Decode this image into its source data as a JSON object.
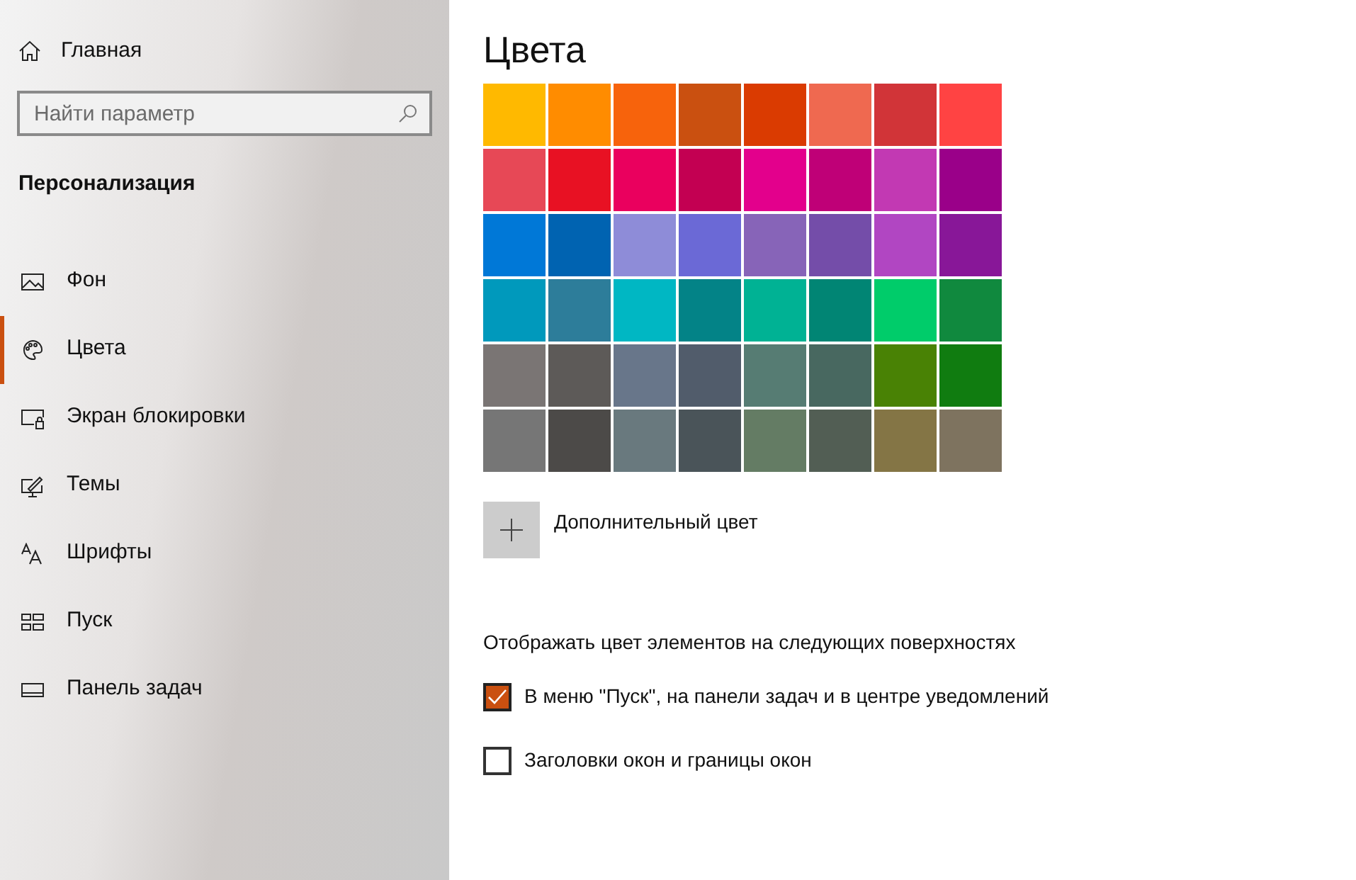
{
  "sidebar": {
    "home": "Главная",
    "search": {
      "placeholder": "Найти параметр"
    },
    "section": "Персонализация",
    "items": [
      {
        "label": "Фон",
        "kind": "background",
        "selected": false
      },
      {
        "label": "Цвета",
        "kind": "colors",
        "selected": true
      },
      {
        "label": "Экран блокировки",
        "kind": "lock",
        "selected": false
      },
      {
        "label": "Темы",
        "kind": "themes",
        "selected": false
      },
      {
        "label": "Шрифты",
        "kind": "fonts",
        "selected": false
      },
      {
        "label": "Пуск",
        "kind": "start",
        "selected": false
      },
      {
        "label": "Панель задач",
        "kind": "taskbar",
        "selected": false
      }
    ]
  },
  "main": {
    "title": "Цвета",
    "swatches": [
      {
        "color": "#ffb900"
      },
      {
        "color": "#ff8c00"
      },
      {
        "color": "#f7630c"
      },
      {
        "color": "#ca5010"
      },
      {
        "color": "#da3b01"
      },
      {
        "color": "#ef6950"
      },
      {
        "color": "#d13438"
      },
      {
        "color": "#ff4343"
      },
      {
        "color": "#e74856"
      },
      {
        "color": "#e81123"
      },
      {
        "color": "#ea005e"
      },
      {
        "color": "#c30052"
      },
      {
        "color": "#e3008c"
      },
      {
        "color": "#bf0077"
      },
      {
        "color": "#c239b3"
      },
      {
        "color": "#9a0089"
      },
      {
        "color": "#0078d7"
      },
      {
        "color": "#0063b1"
      },
      {
        "color": "#8e8cd8"
      },
      {
        "color": "#6b69d6"
      },
      {
        "color": "#8764b8"
      },
      {
        "color": "#744da9"
      },
      {
        "color": "#b146c2"
      },
      {
        "color": "#881798"
      },
      {
        "color": "#0099bc"
      },
      {
        "color": "#2d7d9a"
      },
      {
        "color": "#00b7c3"
      },
      {
        "color": "#038387"
      },
      {
        "color": "#00b294"
      },
      {
        "color": "#018574"
      },
      {
        "color": "#00cc6a"
      },
      {
        "color": "#10893e"
      },
      {
        "color": "#7a7574"
      },
      {
        "color": "#5d5a58"
      },
      {
        "color": "#68768a"
      },
      {
        "color": "#515c6b"
      },
      {
        "color": "#567c73"
      },
      {
        "color": "#486860"
      },
      {
        "color": "#498205"
      },
      {
        "color": "#107c10"
      },
      {
        "color": "#767676"
      },
      {
        "color": "#4c4a48"
      },
      {
        "color": "#69797e"
      },
      {
        "color": "#4a5459"
      },
      {
        "color": "#647c64"
      },
      {
        "color": "#525e54"
      },
      {
        "color": "#847545"
      },
      {
        "color": "#7e735f"
      }
    ],
    "custom_color": "Дополнительный цвет",
    "surfaces_heading": "Отображать цвет элементов на следующих поверхностях",
    "options": [
      {
        "label": "В меню \"Пуск\", на панели задач и в центре уведомлений",
        "checked": true
      },
      {
        "label": "Заголовки окон и границы окон",
        "checked": false
      }
    ]
  }
}
